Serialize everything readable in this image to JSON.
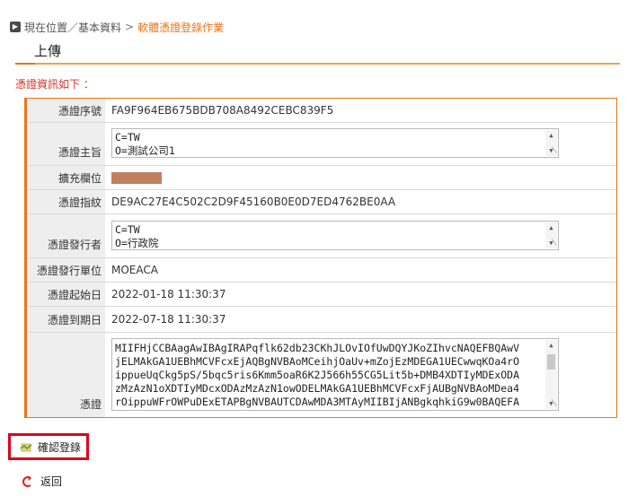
{
  "breadcrumb": {
    "items": [
      "現在位置",
      "基本資料"
    ],
    "separator_1": "／",
    "separator_2": ">",
    "current": "軟體憑證登錄作業"
  },
  "page_title": "上傳",
  "section_label": "憑證資訊如下 ：",
  "fields": {
    "serial": {
      "label": "憑證序號",
      "value": "FA9F964EB675BDB708A8492CEBC839F5"
    },
    "subject": {
      "label": "憑證主旨",
      "lines": [
        "C=TW",
        "O=測試公司1"
      ]
    },
    "extension": {
      "label": "擴充欄位"
    },
    "fingerprint": {
      "label": "憑證指紋",
      "value": "DE9AC27E4C502C2D9F45160B0E0D7ED4762BE0AA"
    },
    "issuer": {
      "label": "憑證發行者",
      "lines": [
        "C=TW",
        "O=行政院"
      ]
    },
    "issuer_unit": {
      "label": "憑證發行單位",
      "value": "MOEACA"
    },
    "start_date": {
      "label": "憑證起始日",
      "value": "2022-01-18 11:30:37"
    },
    "end_date": {
      "label": "憑證到期日",
      "value": "2022-07-18 11:30:37"
    },
    "certificate": {
      "label": "憑證",
      "lines": [
        "MIIFHjCCBAagAwIBAgIRAPqflk62db23CKhJLOvIOfUwDQYJKoZIhvcNAQEFBQAwV",
        "jELMAkGA1UEBhMCVFcxEjAQBgNVBAoMCeihjOaUv+mZojEzMDEGA1UECwwqKOa4rO",
        "ippueUqCkg5pS/5bqc5ris6Kmm5oaR6K2J566h55CG5Lit5b+DMB4XDTIyMDExODA",
        "zMzAzN1oXDTIyMDcxODAzMzAzN1owODELMAkGA1UEBhMCVFcxFjAUBgNVBAoMDea4",
        "rOippuWFrOWPuDExETAPBgNVBAUTCDAwMDA3MTAyMIIBIjANBgkqhkiG9w0BAQEFA"
      ]
    }
  },
  "actions": {
    "confirm_label": "確認登錄",
    "back_label": "返回"
  },
  "colors": {
    "accent": "#e8751a",
    "highlight_border": "#e0001b",
    "label_red": "#d9302a"
  }
}
